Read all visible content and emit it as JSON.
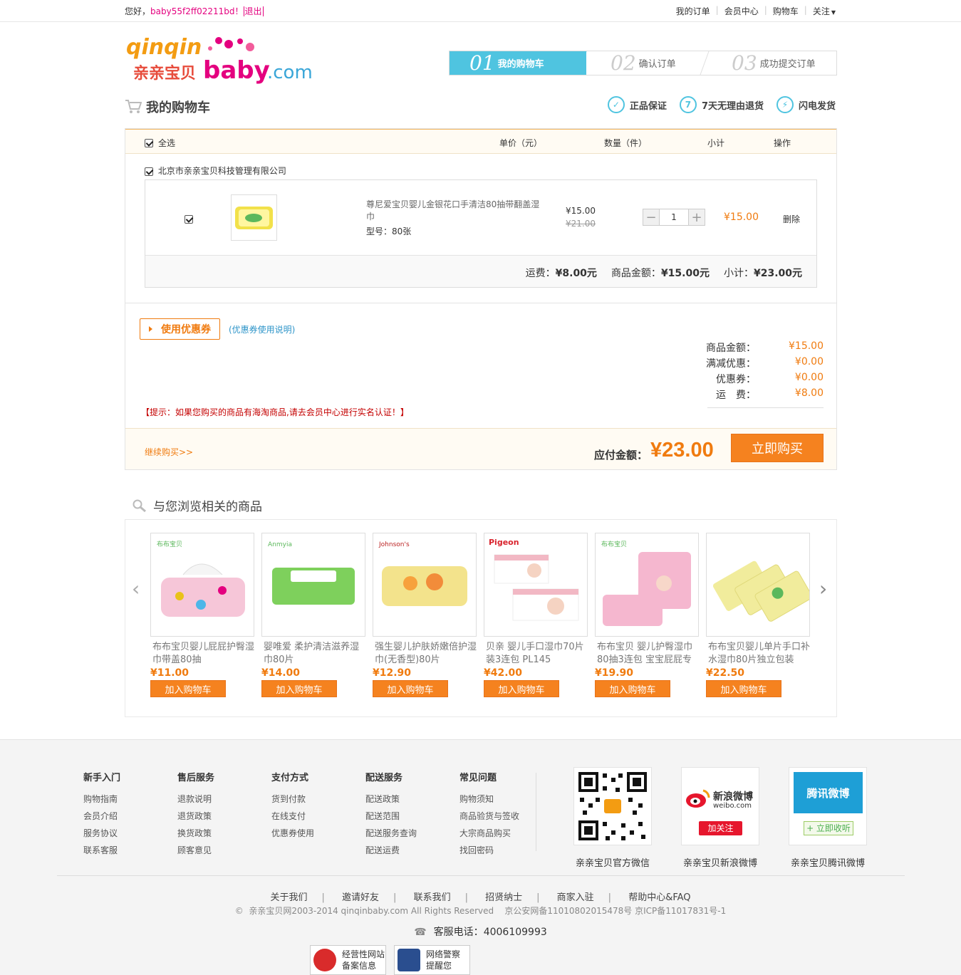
{
  "topbar": {
    "greeting": "您好，",
    "username": "baby55f2ff02211bd",
    "exclaim": "！",
    "logout": "退出",
    "nav": [
      "我的订单",
      "会员中心",
      "购物车",
      "关注"
    ]
  },
  "logo": {
    "text_top": "qinqin",
    "text_cn": "亲亲宝贝",
    "text_baby": "baby",
    "text_com": ".com"
  },
  "steps": [
    {
      "num": "01",
      "label": "我的购物车",
      "active": true
    },
    {
      "num": "02",
      "label": "确认订单",
      "active": false
    },
    {
      "num": "03",
      "label": "成功提交订单",
      "active": false
    }
  ],
  "cart_title": "我的购物车",
  "guarantees": [
    {
      "icon": "shield-icon",
      "glyph": "✓",
      "label": "正品保证"
    },
    {
      "icon": "seven-icon",
      "glyph": "7",
      "label": "7天无理由退货"
    },
    {
      "icon": "lightning-icon",
      "glyph": "⚡",
      "label": "闪电发货"
    }
  ],
  "table_head": {
    "select_all": "全选",
    "price": "单价（元）",
    "qty": "数量（件）",
    "subtotal": "小计",
    "action": "操作"
  },
  "shop": {
    "name": "北京市亲亲宝贝科技管理有限公司"
  },
  "item": {
    "name": "尊尼爱宝贝婴儿金银花口手清洁80抽带翻盖湿巾",
    "spec": "型号：80张",
    "price": "¥15.00",
    "old_price": "¥21.00",
    "qty": "1",
    "subtotal": "¥15.00",
    "delete": "删除"
  },
  "item_footer": {
    "shipping_label": "运费：",
    "shipping": "¥8.00元",
    "goods_label": "商品金额：",
    "goods": "¥15.00元",
    "subtotal_label": "小计：",
    "subtotal": "¥23.00元"
  },
  "coupon": {
    "button": "使用优惠券",
    "help": "(优惠券使用说明)"
  },
  "summary": [
    {
      "label": "商品金额：",
      "value": "¥15.00"
    },
    {
      "label": "满减优惠：",
      "value": "¥0.00"
    },
    {
      "label": "优惠券：",
      "value": "¥0.00"
    },
    {
      "label": "运　费：",
      "value": "¥8.00"
    }
  ],
  "tip": "【提示：如果您购买的商品有海淘商品,请去会员中心进行实名认证！】",
  "checkout": {
    "continue": "继续购买>>",
    "pay_label": "应付金额：",
    "pay_amount": "¥23.00",
    "buy": "立即购买"
  },
  "related": {
    "title": "与您浏览相关的商品",
    "add_label": "加入购物车",
    "products": [
      {
        "name": "布布宝贝婴儿屁屁护臀湿巾带盖80抽",
        "price": "¥11.00",
        "color": "#f6c6d8"
      },
      {
        "name": "婴唯爱 柔护清洁滋养湿巾80片",
        "price": "¥14.00",
        "color": "#7ed05c"
      },
      {
        "name": "强生婴儿护肤娇嫩倍护湿巾(无香型)80片",
        "price": "¥12.90",
        "color": "#f3e38c"
      },
      {
        "name": "贝亲 婴儿手口湿巾70片装3连包 PL145",
        "price": "¥42.00",
        "color": "#f2b8c4"
      },
      {
        "name": "布布宝贝 婴儿护臀湿巾80抽3连包 宝宝屁屁专",
        "price": "¥19.90",
        "color": "#f5b7cf"
      },
      {
        "name": "布布宝贝婴儿单片手口补水湿巾80片独立包装",
        "price": "¥22.50",
        "color": "#f1ec9c"
      }
    ]
  },
  "footer": {
    "columns": [
      {
        "title": "新手入门",
        "items": [
          "购物指南",
          "会员介绍",
          "服务协议",
          "联系客服"
        ]
      },
      {
        "title": "售后服务",
        "items": [
          "退款说明",
          "退货政策",
          "换货政策",
          "顾客意见"
        ]
      },
      {
        "title": "支付方式",
        "items": [
          "货到付款",
          "在线支付",
          "优惠券使用"
        ]
      },
      {
        "title": "配送服务",
        "items": [
          "配送政策",
          "配送范围",
          "配送服务查询",
          "配送运费"
        ]
      },
      {
        "title": "常见问题",
        "items": [
          "购物须知",
          "商品验货与签收",
          "大宗商品购买",
          "找回密码"
        ]
      }
    ],
    "social": [
      {
        "caption": "亲亲宝贝官方微信"
      },
      {
        "caption": "亲亲宝贝新浪微博",
        "brand": "新浪微博",
        "brand_en": "weibo.com",
        "action": "加关注"
      },
      {
        "caption": "亲亲宝贝腾讯微博",
        "brand": "腾讯微博",
        "action": "+ 立即收听"
      }
    ],
    "links": [
      "关于我们",
      "邀请好友",
      "联系我们",
      "招贤纳士",
      "商家入驻",
      "帮助中心&FAQ"
    ],
    "copyright": "©  亲亲宝贝网2003-2014 qinqinbaby.com All Rights Reserved    京公安网备11010802015478号 京ICP备11017831号-1",
    "hotline_label": "客服电话：",
    "hotline": "4006109993",
    "badges": [
      {
        "line1": "经营性网站",
        "line2": "备案信息"
      },
      {
        "line1": "网络警察",
        "line2": "提醒您"
      }
    ]
  }
}
